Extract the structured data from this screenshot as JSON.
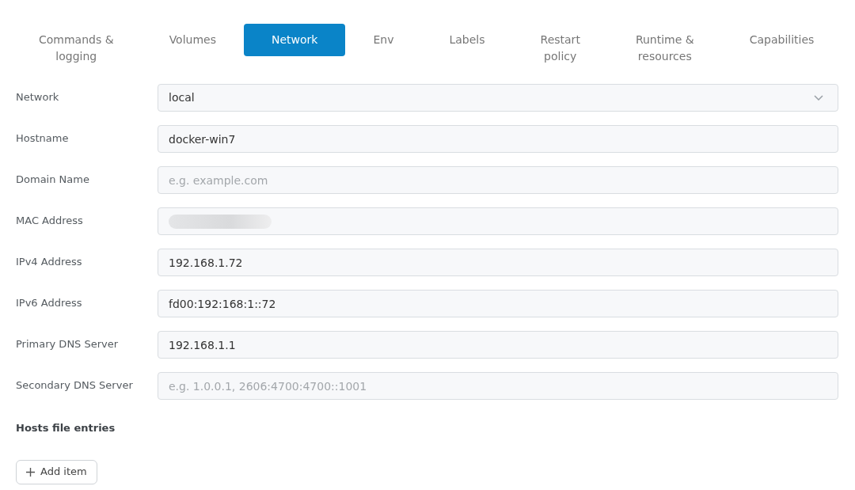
{
  "tabs": [
    {
      "label": "Commands &\nlogging",
      "selected": false
    },
    {
      "label": "Volumes",
      "selected": false
    },
    {
      "label": "Network",
      "selected": true
    },
    {
      "label": "Env",
      "selected": false
    },
    {
      "label": "Labels",
      "selected": false
    },
    {
      "label": "Restart\npolicy",
      "selected": false
    },
    {
      "label": "Runtime &\nresources",
      "selected": false
    },
    {
      "label": "Capabilities",
      "selected": false
    }
  ],
  "fields": [
    {
      "label": "Network",
      "kind": "select",
      "value": "local"
    },
    {
      "label": "Hostname",
      "kind": "input",
      "value": "docker-win7"
    },
    {
      "label": "Domain Name",
      "kind": "input",
      "placeholder": "e.g. example.com"
    },
    {
      "label": "MAC Address",
      "kind": "redacted"
    },
    {
      "label": "IPv4 Address",
      "kind": "input",
      "value": "192.168.1.72"
    },
    {
      "label": "IPv6 Address",
      "kind": "input",
      "value": "fd00:192:168:1::72"
    },
    {
      "label": "Primary DNS Server",
      "kind": "input",
      "value": "192.168.1.1"
    },
    {
      "label": "Secondary DNS Server",
      "kind": "input",
      "placeholder": "e.g. 1.0.0.1, 2606:4700:4700::1001"
    }
  ],
  "hosts_section": {
    "title": "Hosts file entries",
    "add_button": "Add item"
  }
}
